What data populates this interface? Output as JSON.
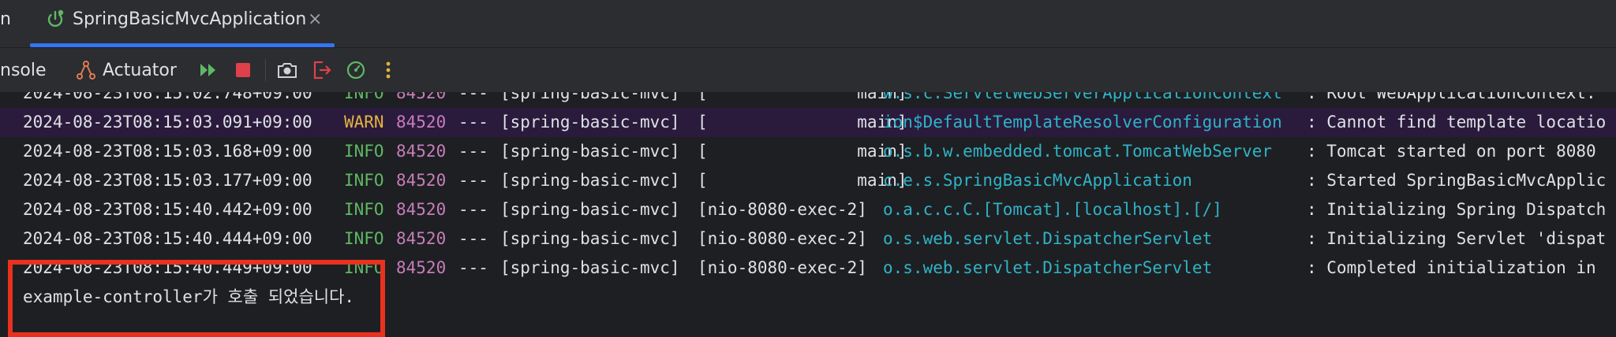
{
  "tabbar": {
    "cut_label": "n",
    "active_tab": {
      "label": "SpringBasicMvcApplication",
      "close": "×"
    }
  },
  "toolbar": {
    "console_label": "nsole",
    "actuator_label": "Actuator"
  },
  "console": {
    "partial_top_line": {
      "timestamp": "2024-08-23T08:15:02.748+09:00",
      "level": "INFO",
      "pid": "84520",
      "dash": "---",
      "app": "[spring-basic-mvc]",
      "thread": "[               main]",
      "logger": "w.s.c.ServletWebServerApplicationContext",
      "message": ": Root WebApplicationContext:"
    },
    "lines": [
      {
        "timestamp": "2024-08-23T08:15:03.091+09:00",
        "level": "WARN",
        "pid": "84520",
        "dash": "---",
        "app": "[spring-basic-mvc]",
        "thread": "[               main]",
        "logger": "ion$DefaultTemplateResolverConfiguration",
        "message": ": Cannot find template locatio"
      },
      {
        "timestamp": "2024-08-23T08:15:03.168+09:00",
        "level": "INFO",
        "pid": "84520",
        "dash": "---",
        "app": "[spring-basic-mvc]",
        "thread": "[               main]",
        "logger": "o.s.b.w.embedded.tomcat.TomcatWebServer",
        "message": ": Tomcat started on port 8080"
      },
      {
        "timestamp": "2024-08-23T08:15:03.177+09:00",
        "level": "INFO",
        "pid": "84520",
        "dash": "---",
        "app": "[spring-basic-mvc]",
        "thread": "[               main]",
        "logger": "c.e.s.SpringBasicMvcApplication",
        "message": ": Started SpringBasicMvcApplic"
      },
      {
        "timestamp": "2024-08-23T08:15:40.442+09:00",
        "level": "INFO",
        "pid": "84520",
        "dash": "---",
        "app": "[spring-basic-mvc]",
        "thread": "[nio-8080-exec-2]",
        "logger": "o.a.c.c.C.[Tomcat].[localhost].[/]",
        "message": ": Initializing Spring Dispatch"
      },
      {
        "timestamp": "2024-08-23T08:15:40.444+09:00",
        "level": "INFO",
        "pid": "84520",
        "dash": "---",
        "app": "[spring-basic-mvc]",
        "thread": "[nio-8080-exec-2]",
        "logger": "o.s.web.servlet.DispatcherServlet",
        "message": ": Initializing Servlet 'dispat"
      },
      {
        "timestamp": "2024-08-23T08:15:40.449+09:00",
        "level": "INFO",
        "pid": "84520",
        "dash": "---",
        "app": "[spring-basic-mvc]",
        "thread": "[nio-8080-exec-2]",
        "logger": "o.s.web.servlet.DispatcherServlet",
        "message": ": Completed initialization in"
      }
    ],
    "output_line": "example-controller가 호출 되었습니다."
  },
  "colors": {
    "info": "#5fb865",
    "warn": "#e3b341",
    "pid": "#c77dbb",
    "logger": "#2fb3c7",
    "highlight": "#e8321f",
    "accent": "#3574f0"
  },
  "icons": [
    "power-icon",
    "actuator-icon",
    "rerun-icon",
    "stop-icon",
    "camera-icon",
    "exit-icon",
    "profiler-icon",
    "more-icon",
    "close-icon"
  ]
}
